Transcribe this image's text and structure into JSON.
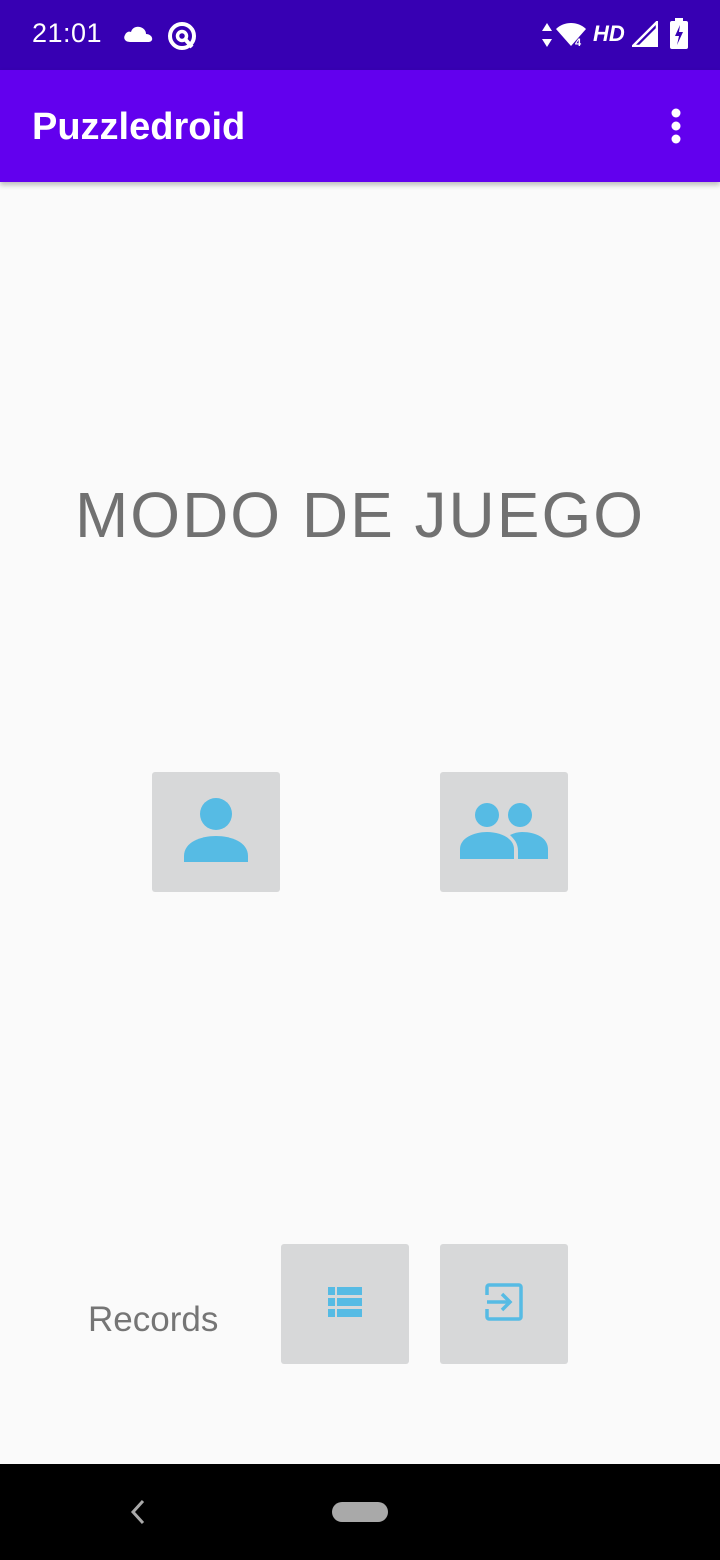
{
  "status_bar": {
    "time": "21:01",
    "network": "HD",
    "icons": [
      "cloud-icon",
      "at-icon",
      "data-arrows-icon",
      "wifi-icon",
      "signal-icon",
      "battery-icon"
    ]
  },
  "app_bar": {
    "title": "Puzzledroid",
    "menu_icon": "more-vert-icon"
  },
  "main": {
    "heading": "MODO DE JUEGO",
    "single_player_icon": "person-icon",
    "multi_player_icon": "people-icon"
  },
  "footer": {
    "records_label": "Records",
    "records_icon": "list-icon",
    "exit_icon": "exit-icon"
  },
  "colors": {
    "status_bar": "#3700b3",
    "app_bar": "#6200ee",
    "icon_accent": "#56bbe4",
    "button_bg": "#d7d8d9",
    "text_gray": "#717171"
  }
}
